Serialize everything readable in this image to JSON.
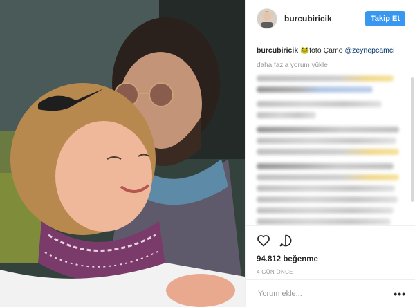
{
  "post": {
    "username": "burcubiricik",
    "follow_label": "Takip Et"
  },
  "caption": {
    "user": "burcubiricik",
    "icon": "frog-emoji",
    "text": "foto Çamo",
    "mention": "@zeynepcamci"
  },
  "comments": {
    "load_more": "daha fazla yorum yükle"
  },
  "stats": {
    "likes": "94.812 beğenme",
    "time": "4 GÜN ÖNCE"
  },
  "comment_box": {
    "placeholder": "Yorum ekle...",
    "more": "•••"
  },
  "colors": {
    "accent": "#3897f0",
    "mention": "#003569"
  }
}
